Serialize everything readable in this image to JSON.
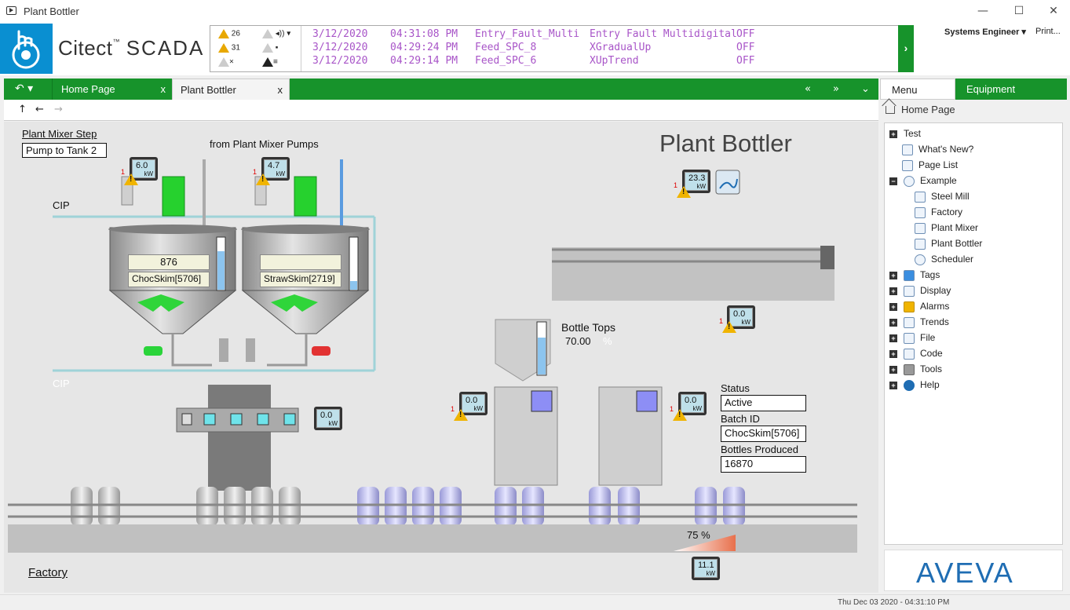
{
  "window": {
    "title": "Plant Bottler",
    "min": "—",
    "max": "☐",
    "close": "✕"
  },
  "brand": {
    "name": "Citect",
    "tm": "™",
    "product": "SCADA"
  },
  "alarm_counts": {
    "active": "26",
    "unack": "31"
  },
  "alarms": [
    {
      "date": "3/12/2020",
      "time": "04:31:08 PM",
      "tag": "Entry_Fault_Multi",
      "desc": "Entry Fault Multidigital",
      "state": "OFF"
    },
    {
      "date": "3/12/2020",
      "time": "04:29:24 PM",
      "tag": "Feed_SPC_8",
      "desc": "XGradualUp",
      "state": "OFF"
    },
    {
      "date": "3/12/2020",
      "time": "04:29:14 PM",
      "tag": "Feed_SPC_6",
      "desc": "XUpTrend",
      "state": "OFF"
    }
  ],
  "user": {
    "name": "Systems Engineer",
    "print": "Print..."
  },
  "tabs": [
    {
      "label": "Home Page",
      "close": "x"
    },
    {
      "label": "Plant Bottler",
      "close": "x"
    }
  ],
  "right_tabs": {
    "menu": "Menu",
    "equipment": "Equipment"
  },
  "tree": {
    "home": "Home Page",
    "items": [
      {
        "label": "Test"
      },
      {
        "label": "What's New?"
      },
      {
        "label": "Page List"
      },
      {
        "label": "Example"
      },
      {
        "label": "Steel Mill"
      },
      {
        "label": "Factory"
      },
      {
        "label": "Plant Mixer"
      },
      {
        "label": "Plant Bottler"
      },
      {
        "label": "Scheduler"
      },
      {
        "label": "Tags"
      },
      {
        "label": "Display"
      },
      {
        "label": "Alarms"
      },
      {
        "label": "Trends"
      },
      {
        "label": "File"
      },
      {
        "label": "Code"
      },
      {
        "label": "Tools"
      },
      {
        "label": "Help"
      }
    ]
  },
  "vendor": "AVEVA",
  "status_time": "Thu Dec 03 2020 - 04:31:10 PM",
  "mimic": {
    "title": "Plant Bottler",
    "mixer_step_link": "Plant Mixer Step",
    "mixer_step_value": "Pump to Tank 2",
    "from_pumps": "from Plant Mixer Pumps",
    "cip_top": "CIP",
    "cip_bottom": "CIP",
    "tank1_value": "876",
    "tank1_product": "ChocSkim[5706]",
    "tank2_value": "",
    "tank2_product": "StrawSkim[2719]",
    "bottle_tops_label": "Bottle Tops",
    "bottle_tops_value": "70.00",
    "bottle_tops_unit": "%",
    "status_label": "Status",
    "status_value": "Active",
    "batch_label": "Batch ID",
    "batch_value": "ChocSkim[5706]",
    "produced_label": "Bottles Produced",
    "produced_value": "16870",
    "speed": "75 %",
    "factory_link": "Factory",
    "kw_unit": "kW",
    "alarm_count": "1",
    "meters": {
      "mixer1": "6.0",
      "mixer2": "4.7",
      "main": "23.3",
      "filler": "0.0",
      "conveyor_top": "0.0",
      "capper1": "0.0",
      "capper2": "0.0",
      "conveyor": "11.1"
    }
  }
}
